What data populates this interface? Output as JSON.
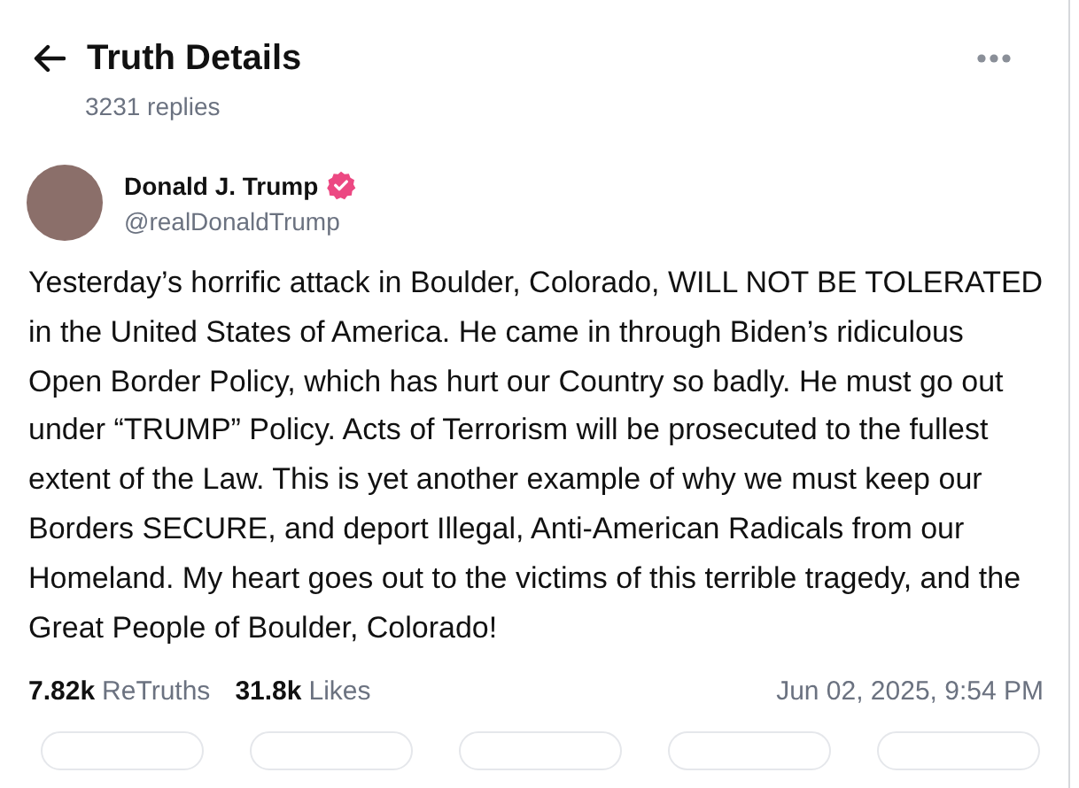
{
  "header": {
    "title": "Truth Details",
    "subtitle": "3231 replies"
  },
  "author": {
    "name": "Donald J. Trump",
    "verified": true,
    "handle": "@realDonaldTrump"
  },
  "post": {
    "text": "Yesterday’s horrific attack in Boulder, Colorado, WILL NOT BE TOLERATED in the United States of America. He came in through Biden’s ridiculous Open Border Policy, which has hurt our Country so badly. He must go out under “TRUMP” Policy. Acts of Terrorism will be prosecuted to the fullest extent of the Law. This is yet another example of why we must keep our Borders SECURE, and deport Illegal, Anti-American Radicals from our Homeland. My heart goes out to the victims of this terrible tragedy, and the Great People of Boulder, Colorado!"
  },
  "stats": [
    {
      "count": "7.82k",
      "label": "ReTruths"
    },
    {
      "count": "31.8k",
      "label": "Likes"
    }
  ],
  "timestamp": "Jun 02, 2025, 9:54 PM"
}
